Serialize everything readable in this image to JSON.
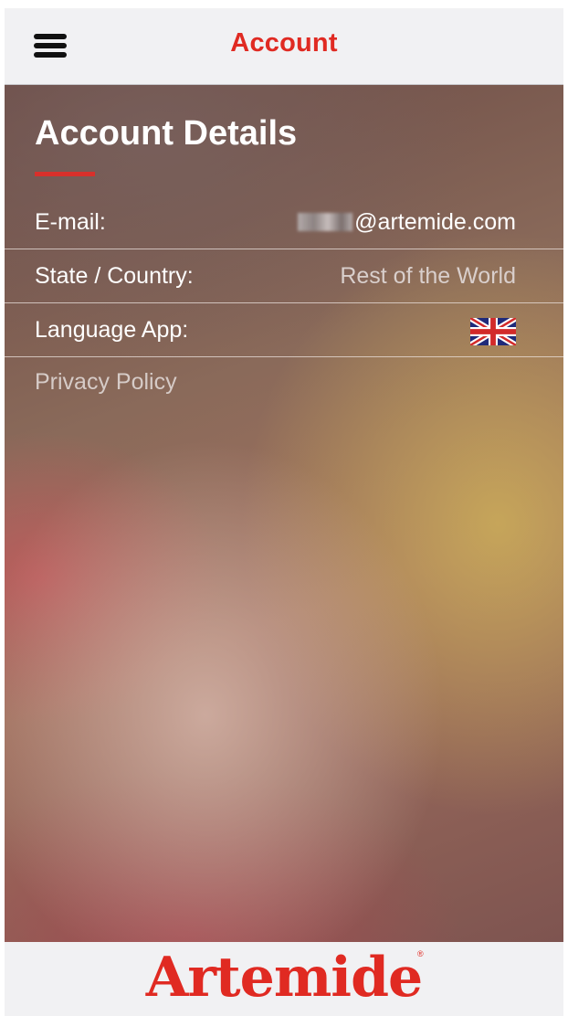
{
  "header": {
    "title": "Account"
  },
  "account": {
    "section_title": "Account Details",
    "rows": [
      {
        "label": "E-mail:",
        "value": "@artemide.com"
      },
      {
        "label": "State / Country:",
        "value": "Rest of the World"
      },
      {
        "label": "Language App:",
        "value_icon": "uk-flag-icon"
      }
    ],
    "privacy_link": "Privacy Policy"
  },
  "footer": {
    "logo_text": "Artemide",
    "logo_mark": "®"
  },
  "colors": {
    "accent": "#e02a22",
    "bar_background": "#f1f1f3"
  }
}
